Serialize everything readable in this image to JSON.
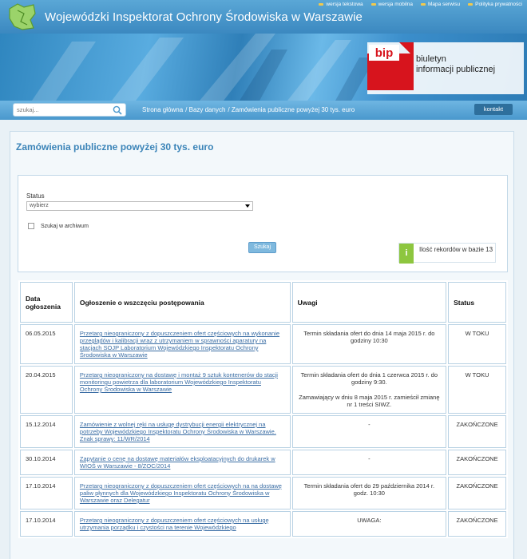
{
  "header": {
    "title": "Wojewódzki Inspektorat Ochrony Środowiska w Warszawie",
    "links": [
      "wersja tekstowa",
      "wersja mobilna",
      "Mapa serwisu",
      "Polityka prywatności"
    ],
    "bip_text_line1": "biuletyn",
    "bip_text_line2": "informacji publicznej",
    "bip_logo": "bip"
  },
  "nav": {
    "search_placeholder": "szukaj...",
    "breadcrumb": [
      "Strona główna",
      "/ Bazy danych",
      "/ Zamówienia publiczne powyżej 30 tys. euro"
    ],
    "contact": "kontakt"
  },
  "page": {
    "title": "Zamówienia publiczne powyżej 30 tys. euro"
  },
  "filter": {
    "status_label": "Status",
    "status_value": "wybierz",
    "archive_label": "Szukaj w archiwum",
    "search_button": "Szukaj",
    "records_info_icon": "i",
    "records_text": "Ilość rekordów w bazie 13"
  },
  "table": {
    "headers": [
      "Data ogłoszenia",
      "Ogłoszenie o wszczęciu postępowania",
      "Uwagi",
      "Status"
    ],
    "rows": [
      {
        "date": "06.05.2015",
        "announcement": "Przetarg nieograniczony z dopuszczeniem ofert częściowych na wykonanie przeglądów i kalibracji wraz z utrzymaniem w sprawności aparatury na stacjach SOJP Laboratorium Wojewódzkiego Inspektoratu Ochrony Środowiska w Warszawie",
        "notes": [
          "Termin składania ofert do dnia 14 maja 2015 r. do godziny 10:30"
        ],
        "status": "W TOKU"
      },
      {
        "date": "20.04.2015",
        "announcement": "Przetarg nieograniczony na dostawę i montaż 9 sztuk kontenerów do stacji monitoringu powietrza dla laboratorium Wojewódzkiego Inspektoratu Ochrony Środowiska w Warszawie",
        "notes": [
          "Termin składania ofert do dnia 1 czerwca 2015 r. do godziny 9:30.",
          "Zamawiający w dniu 8 maja 2015 r. zamieścił zmianę nr 1 treści SIWZ."
        ],
        "status": "W TOKU"
      },
      {
        "date": "15.12.2014",
        "announcement": "Zamówienie z wolnej ręki na usługę dystrybucji energii elektrycznej na potrzeby Wojewódzkiego Inspektoratu Ochrony Środowiska w Warszawie. Znak sprawy: 11/WR/2014",
        "notes": [
          "-"
        ],
        "status": "ZAKOŃCZONE"
      },
      {
        "date": "30.10.2014",
        "announcement": "Zapytanie o cenę na dostawę materiałów eksploatacyjnych do drukarek w WIOŚ w Warszawie - 8/ZOC/2014",
        "notes": [
          "-"
        ],
        "status": "ZAKOŃCZONE"
      },
      {
        "date": "17.10.2014",
        "announcement": "Przetarg nieograniczony z dopuszczeniem ofert częściowych na na dostawę paliw płynnych dla Wojewódzkiego Inspektoratu Ochrony Środowiska w Warszawie oraz Delegatur",
        "notes": [
          "Termin składania ofert do 29 października 2014 r. godz. 10:30"
        ],
        "status": "ZAKOŃCZONE"
      },
      {
        "date": "17.10.2014",
        "announcement": "Przetarg nieograniczony z dopuszczeniem ofert częściowych na usługę utrzymania porządku i czystości na terenie Wojewódzkiego",
        "notes": [
          "UWAGA:"
        ],
        "status": "ZAKOŃCZONE"
      }
    ]
  },
  "colors": {
    "header_blue": "#3b88c0",
    "title_blue": "#3b84b8",
    "link_blue": "#3b6ea5",
    "bip_red": "#d7141d",
    "info_green": "#8dc63f"
  }
}
